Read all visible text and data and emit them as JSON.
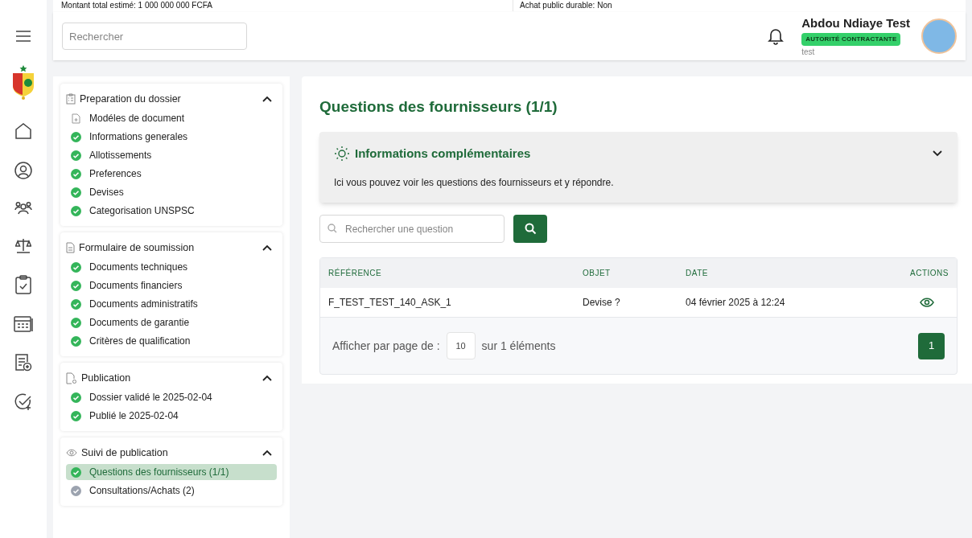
{
  "top_strip": [
    "Montant total estimé: 1 000 000 000 FCFA",
    "Achat public durable: Non"
  ],
  "header": {
    "search": {
      "placeholder": "Rechercher"
    },
    "user": {
      "name": "Abdou Ndiaye Test",
      "role": "AUTORITÉ CONTRACTANTE",
      "username": "test"
    }
  },
  "sections": [
    {
      "title": "Preparation du dossier",
      "expanded": true,
      "items": [
        {
          "label": "Modéles de document",
          "kind": "document",
          "selected": false
        },
        {
          "label": "Informations generales",
          "kind": "step",
          "done": true,
          "selected": false
        },
        {
          "label": "Allotissements",
          "kind": "step",
          "done": true,
          "selected": false
        },
        {
          "label": "Preferences",
          "kind": "step",
          "done": true,
          "selected": false
        },
        {
          "label": "Devises",
          "kind": "step",
          "done": true,
          "selected": false
        },
        {
          "label": "Categorisation UNSPSC",
          "kind": "step",
          "done": true,
          "selected": false
        }
      ]
    },
    {
      "title": "Formulaire de soumission",
      "expanded": true,
      "items": [
        {
          "label": "Documents techniques",
          "kind": "step",
          "done": true,
          "selected": false
        },
        {
          "label": "Documents financiers",
          "kind": "step",
          "done": true,
          "selected": false
        },
        {
          "label": "Documents administratifs",
          "kind": "step",
          "done": true,
          "selected": false
        },
        {
          "label": "Documents de garantie",
          "kind": "step",
          "done": true,
          "selected": false
        },
        {
          "label": "Critères de qualification",
          "kind": "step",
          "done": true,
          "selected": false
        }
      ]
    },
    {
      "title": "Publication",
      "expanded": true,
      "items": [
        {
          "label": "Dossier validé le 2025-02-04",
          "kind": "step",
          "done": true,
          "selected": false
        },
        {
          "label": "Publié le 2025-02-04",
          "kind": "step",
          "done": true,
          "selected": false
        }
      ]
    },
    {
      "title": "Suivi de publication",
      "expanded": true,
      "items": [
        {
          "label": "Questions des fournisseurs (1/1)",
          "kind": "step",
          "done": true,
          "selected": true
        },
        {
          "label": "Consultations/Achats (2)",
          "kind": "step",
          "done": false,
          "selected": false
        }
      ]
    }
  ],
  "main": {
    "title": "Questions des fournisseurs (1/1)",
    "info": {
      "title": "Informations complémentaires",
      "expanded": true,
      "text": "Ici vous pouvez voir les questions des fournisseurs et y répondre."
    },
    "search": {
      "placeholder": "Rechercher une question"
    },
    "table": {
      "columns": [
        "RÉFÉRENCE",
        "OBJET",
        "DATE",
        "ACTIONS"
      ],
      "rows": [
        {
          "reference": "F_TEST_TEST_140_ASK_1",
          "objet": "Devise ?",
          "date": "04 février 2025 à 12:24"
        }
      ]
    },
    "pagination": {
      "label": "Afficher par page de :",
      "per_page": "10",
      "total": "sur 1 éléments",
      "pages": [
        {
          "label": "1",
          "selected": true
        }
      ]
    }
  }
}
